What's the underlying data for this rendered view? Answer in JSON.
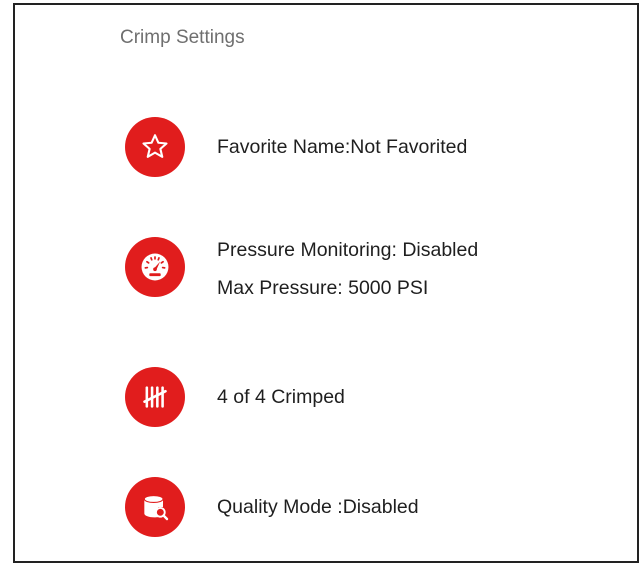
{
  "header": {
    "title": "Crimp Settings"
  },
  "settings": [
    {
      "icon": "star-icon",
      "lines": [
        "Favorite Name:Not Favorited"
      ]
    },
    {
      "icon": "gauge-icon",
      "lines": [
        "Pressure Monitoring: Disabled",
        "Max Pressure: 5000 PSI"
      ]
    },
    {
      "icon": "tally-icon",
      "lines": [
        "4 of 4 Crimped"
      ]
    },
    {
      "icon": "quality-search-icon",
      "lines": [
        "Quality Mode :Disabled"
      ]
    }
  ],
  "colors": {
    "accent": "#e11d1d",
    "title": "#6f6f6f",
    "text": "#1f1f1f",
    "border": "#222222"
  }
}
